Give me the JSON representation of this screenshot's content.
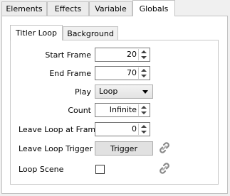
{
  "tabs": [
    "Elements",
    "Effects",
    "Variable",
    "Globals"
  ],
  "subtabs": [
    "Titler Loop",
    "Background"
  ],
  "fields": {
    "start_frame": {
      "label": "Start Frame",
      "value": "20"
    },
    "end_frame": {
      "label": "End Frame",
      "value": "70"
    },
    "play": {
      "label": "Play",
      "value": "Loop"
    },
    "count": {
      "label": "Count",
      "value": "Infinite"
    },
    "leave_loop_at_frame": {
      "label": "Leave Loop at Frame",
      "value": "0"
    },
    "leave_loop_trigger": {
      "label": "Leave Loop Trigger",
      "button": "Trigger"
    },
    "loop_scene": {
      "label": "Loop Scene",
      "checked": false
    }
  },
  "icons": {
    "link": "link-icon"
  }
}
